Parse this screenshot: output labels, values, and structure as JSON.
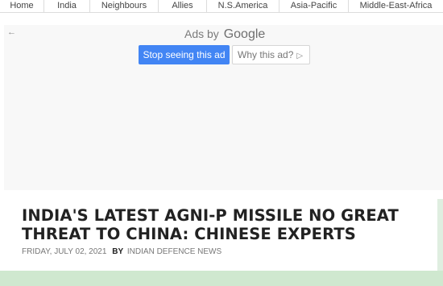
{
  "nav": {
    "items": [
      "Home",
      "India",
      "Neighbours",
      "Allies",
      "N.S.America",
      "Asia-Pacific",
      "Middle-East-Africa"
    ]
  },
  "ad": {
    "back_icon": "back-arrow-icon",
    "ads_by_text": "Ads by",
    "ads_by_brand": "Google",
    "stop_label": "Stop seeing this ad",
    "why_label": "Why this ad?",
    "why_icon": "info-triangle-icon",
    "button_color": "#4285f4"
  },
  "article": {
    "headline": "INDIA'S LATEST AGNI-P MISSILE NO GREAT THREAT TO CHINA: CHINESE EXPERTS",
    "date": "FRIDAY, JULY 02, 2021",
    "by_label": "BY",
    "author": "INDIAN DEFENCE NEWS"
  },
  "colors": {
    "bottom_bar": "#cfe8cf"
  }
}
